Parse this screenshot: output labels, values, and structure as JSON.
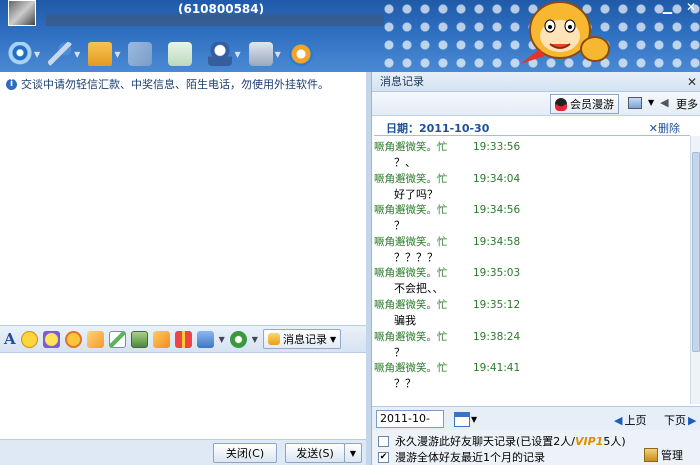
{
  "window": {
    "contact_id": "(610800584)"
  },
  "toolbar": {
    "items": [
      {
        "name": "video-icon",
        "color": "#3a9be0",
        "has_menu": true
      },
      {
        "name": "microphone-icon",
        "color": "#4f8bd6",
        "has_menu": true
      },
      {
        "name": "folder-transfer-icon",
        "color": "#f0a830",
        "has_menu": true
      },
      {
        "name": "mail-icon",
        "color": "#9db3d1",
        "has_menu": false
      },
      {
        "name": "add-app-icon",
        "color": "#3cae4a",
        "has_menu": false
      },
      {
        "name": "user-card-icon",
        "color": "#5c7bb0",
        "has_menu": true
      },
      {
        "name": "settings-icon",
        "color": "#7d8fa8",
        "has_menu": true
      },
      {
        "name": "qq-app-icon",
        "color": "#f2a32b",
        "has_menu": false
      }
    ]
  },
  "notice": "交谈中请勿轻信汇款、中奖信息、陌生电话，勿使用外挂软件。",
  "format_toolbar": {
    "icons": [
      "font-icon",
      "emoji-icon",
      "magic-emoji-icon",
      "scribble-icon",
      "poke-icon",
      "edit-icon",
      "screenshot-icon",
      "music-icon",
      "gift-icon",
      "image-icon",
      "tag-icon"
    ],
    "message_log_label": "消息记录"
  },
  "buttons": {
    "close": "关闭(C)",
    "send": "发送(S)"
  },
  "history": {
    "panel_title": "消息记录",
    "vip_roam": "会员漫游",
    "more": "更多",
    "date_label": "日期：2011-10-30",
    "delete": "删除",
    "messages": [
      {
        "sender": "噘角邂微笑。忙",
        "time": "19:33:56",
        "text": "？、"
      },
      {
        "sender": "噘角邂微笑。忙",
        "time": "19:34:04",
        "text": "好了吗？"
      },
      {
        "sender": "噘角邂微笑。忙",
        "time": "19:34:56",
        "text": "？"
      },
      {
        "sender": "噘角邂微笑。忙",
        "time": "19:34:58",
        "text": "？？？？"
      },
      {
        "sender": "噘角邂微笑。忙",
        "time": "19:35:03",
        "text": "不会把、、"
      },
      {
        "sender": "噘角邂微笑。忙",
        "time": "19:35:12",
        "text": "骗我"
      },
      {
        "sender": "噘角邂微笑。忙",
        "time": "19:38:24",
        "text": "？"
      },
      {
        "sender": "噘角邂微笑。忙",
        "time": "19:41:41",
        "text": "？？"
      }
    ],
    "date_input": "2011-10-30",
    "prev_page": "上页",
    "next_page": "下页",
    "option1_prefix": "永久漫游此好友聊天记录(已设置2人/",
    "vip_label": "VIP1",
    "option1_suffix": "5人)",
    "option1_checked": false,
    "option2": "漫游全体好友最近1个月的记录",
    "option2_checked": true,
    "manage": "管理"
  }
}
